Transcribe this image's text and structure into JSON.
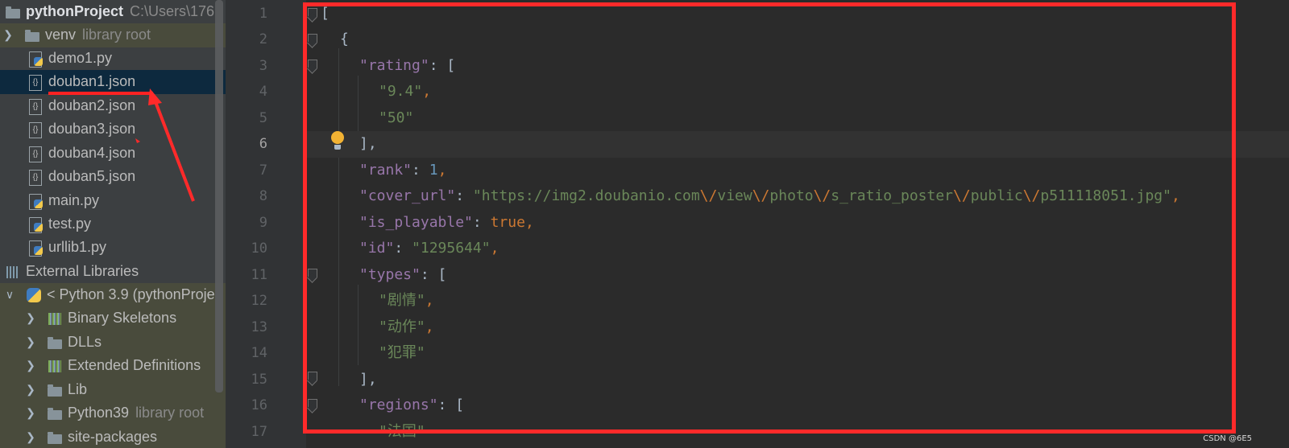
{
  "project_tree": {
    "root": {
      "name": "pythonProject",
      "path": "C:\\Users\\176"
    },
    "items": [
      {
        "label": "venv",
        "suffix": "library root"
      },
      {
        "label": "demo1.py"
      },
      {
        "label": "douban1.json"
      },
      {
        "label": "douban2.json"
      },
      {
        "label": "douban3.json"
      },
      {
        "label": "douban4.json"
      },
      {
        "label": "douban5.json"
      },
      {
        "label": "main.py"
      },
      {
        "label": "test.py"
      },
      {
        "label": "urllib1.py"
      },
      {
        "label": "External Libraries"
      },
      {
        "label": "< Python 3.9 (pythonProje"
      },
      {
        "label": "Binary Skeletons"
      },
      {
        "label": "DLLs"
      },
      {
        "label": "Extended Definitions"
      },
      {
        "label": "Lib"
      },
      {
        "label": "Python39",
        "suffix": "library root"
      },
      {
        "label": "site-packages"
      }
    ]
  },
  "editor": {
    "current_line": 6,
    "line_numbers": [
      "1",
      "2",
      "3",
      "4",
      "5",
      "6",
      "7",
      "8",
      "9",
      "10",
      "11",
      "12",
      "13",
      "14",
      "15",
      "16",
      "17"
    ],
    "code": {
      "l1": "[",
      "l2": "{",
      "l3_key": "\"rating\"",
      "l3_rest": ": [",
      "l4": "\"9.4\"",
      "l5": "\"50\"",
      "l6": "],",
      "l7_key": "\"rank\"",
      "l7_val": "1",
      "l8_key": "\"cover_url\"",
      "l8_s1": "\"https://img2.doubanio.com",
      "l8_s2": "view",
      "l8_s3": "photo",
      "l8_s4": "s_ratio_poster",
      "l8_s5": "public",
      "l8_s6": "p511118051.jpg\"",
      "esc": "\\/",
      "l9_key": "\"is_playable\"",
      "l9_val": "true",
      "l10_key": "\"id\"",
      "l10_val": "\"1295644\"",
      "l11_key": "\"types\"",
      "l11_rest": ": [",
      "l12": "\"剧情\"",
      "l13": "\"动作\"",
      "l14": "\"犯罪\"",
      "l15": "],",
      "l16_key": "\"regions\"",
      "l16_rest": ": [",
      "l17": "\"法国\""
    }
  },
  "watermark": "CSDN @6E5",
  "colors": {
    "highlight_box": "#ff2a2a",
    "selection": "#0d293e"
  }
}
